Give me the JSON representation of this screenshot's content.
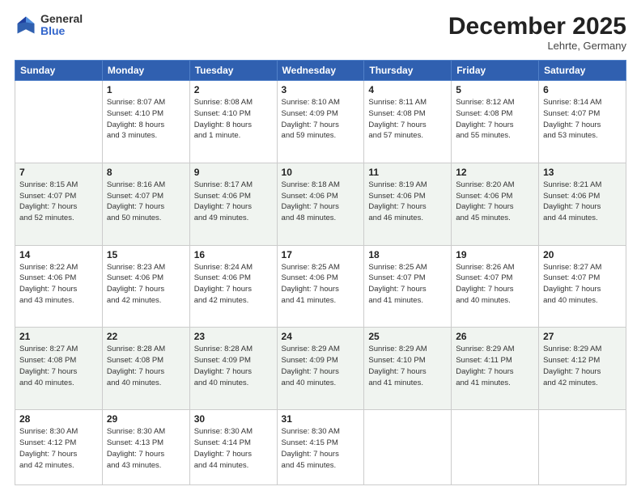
{
  "logo": {
    "general": "General",
    "blue": "Blue"
  },
  "title": "December 2025",
  "location": "Lehrte, Germany",
  "days_of_week": [
    "Sunday",
    "Monday",
    "Tuesday",
    "Wednesday",
    "Thursday",
    "Friday",
    "Saturday"
  ],
  "weeks": [
    [
      {
        "day": "",
        "info": ""
      },
      {
        "day": "1",
        "info": "Sunrise: 8:07 AM\nSunset: 4:10 PM\nDaylight: 8 hours\nand 3 minutes."
      },
      {
        "day": "2",
        "info": "Sunrise: 8:08 AM\nSunset: 4:10 PM\nDaylight: 8 hours\nand 1 minute."
      },
      {
        "day": "3",
        "info": "Sunrise: 8:10 AM\nSunset: 4:09 PM\nDaylight: 7 hours\nand 59 minutes."
      },
      {
        "day": "4",
        "info": "Sunrise: 8:11 AM\nSunset: 4:08 PM\nDaylight: 7 hours\nand 57 minutes."
      },
      {
        "day": "5",
        "info": "Sunrise: 8:12 AM\nSunset: 4:08 PM\nDaylight: 7 hours\nand 55 minutes."
      },
      {
        "day": "6",
        "info": "Sunrise: 8:14 AM\nSunset: 4:07 PM\nDaylight: 7 hours\nand 53 minutes."
      }
    ],
    [
      {
        "day": "7",
        "info": "Sunrise: 8:15 AM\nSunset: 4:07 PM\nDaylight: 7 hours\nand 52 minutes."
      },
      {
        "day": "8",
        "info": "Sunrise: 8:16 AM\nSunset: 4:07 PM\nDaylight: 7 hours\nand 50 minutes."
      },
      {
        "day": "9",
        "info": "Sunrise: 8:17 AM\nSunset: 4:06 PM\nDaylight: 7 hours\nand 49 minutes."
      },
      {
        "day": "10",
        "info": "Sunrise: 8:18 AM\nSunset: 4:06 PM\nDaylight: 7 hours\nand 48 minutes."
      },
      {
        "day": "11",
        "info": "Sunrise: 8:19 AM\nSunset: 4:06 PM\nDaylight: 7 hours\nand 46 minutes."
      },
      {
        "day": "12",
        "info": "Sunrise: 8:20 AM\nSunset: 4:06 PM\nDaylight: 7 hours\nand 45 minutes."
      },
      {
        "day": "13",
        "info": "Sunrise: 8:21 AM\nSunset: 4:06 PM\nDaylight: 7 hours\nand 44 minutes."
      }
    ],
    [
      {
        "day": "14",
        "info": "Sunrise: 8:22 AM\nSunset: 4:06 PM\nDaylight: 7 hours\nand 43 minutes."
      },
      {
        "day": "15",
        "info": "Sunrise: 8:23 AM\nSunset: 4:06 PM\nDaylight: 7 hours\nand 42 minutes."
      },
      {
        "day": "16",
        "info": "Sunrise: 8:24 AM\nSunset: 4:06 PM\nDaylight: 7 hours\nand 42 minutes."
      },
      {
        "day": "17",
        "info": "Sunrise: 8:25 AM\nSunset: 4:06 PM\nDaylight: 7 hours\nand 41 minutes."
      },
      {
        "day": "18",
        "info": "Sunrise: 8:25 AM\nSunset: 4:07 PM\nDaylight: 7 hours\nand 41 minutes."
      },
      {
        "day": "19",
        "info": "Sunrise: 8:26 AM\nSunset: 4:07 PM\nDaylight: 7 hours\nand 40 minutes."
      },
      {
        "day": "20",
        "info": "Sunrise: 8:27 AM\nSunset: 4:07 PM\nDaylight: 7 hours\nand 40 minutes."
      }
    ],
    [
      {
        "day": "21",
        "info": "Sunrise: 8:27 AM\nSunset: 4:08 PM\nDaylight: 7 hours\nand 40 minutes."
      },
      {
        "day": "22",
        "info": "Sunrise: 8:28 AM\nSunset: 4:08 PM\nDaylight: 7 hours\nand 40 minutes."
      },
      {
        "day": "23",
        "info": "Sunrise: 8:28 AM\nSunset: 4:09 PM\nDaylight: 7 hours\nand 40 minutes."
      },
      {
        "day": "24",
        "info": "Sunrise: 8:29 AM\nSunset: 4:09 PM\nDaylight: 7 hours\nand 40 minutes."
      },
      {
        "day": "25",
        "info": "Sunrise: 8:29 AM\nSunset: 4:10 PM\nDaylight: 7 hours\nand 41 minutes."
      },
      {
        "day": "26",
        "info": "Sunrise: 8:29 AM\nSunset: 4:11 PM\nDaylight: 7 hours\nand 41 minutes."
      },
      {
        "day": "27",
        "info": "Sunrise: 8:29 AM\nSunset: 4:12 PM\nDaylight: 7 hours\nand 42 minutes."
      }
    ],
    [
      {
        "day": "28",
        "info": "Sunrise: 8:30 AM\nSunset: 4:12 PM\nDaylight: 7 hours\nand 42 minutes."
      },
      {
        "day": "29",
        "info": "Sunrise: 8:30 AM\nSunset: 4:13 PM\nDaylight: 7 hours\nand 43 minutes."
      },
      {
        "day": "30",
        "info": "Sunrise: 8:30 AM\nSunset: 4:14 PM\nDaylight: 7 hours\nand 44 minutes."
      },
      {
        "day": "31",
        "info": "Sunrise: 8:30 AM\nSunset: 4:15 PM\nDaylight: 7 hours\nand 45 minutes."
      },
      {
        "day": "",
        "info": ""
      },
      {
        "day": "",
        "info": ""
      },
      {
        "day": "",
        "info": ""
      }
    ]
  ]
}
